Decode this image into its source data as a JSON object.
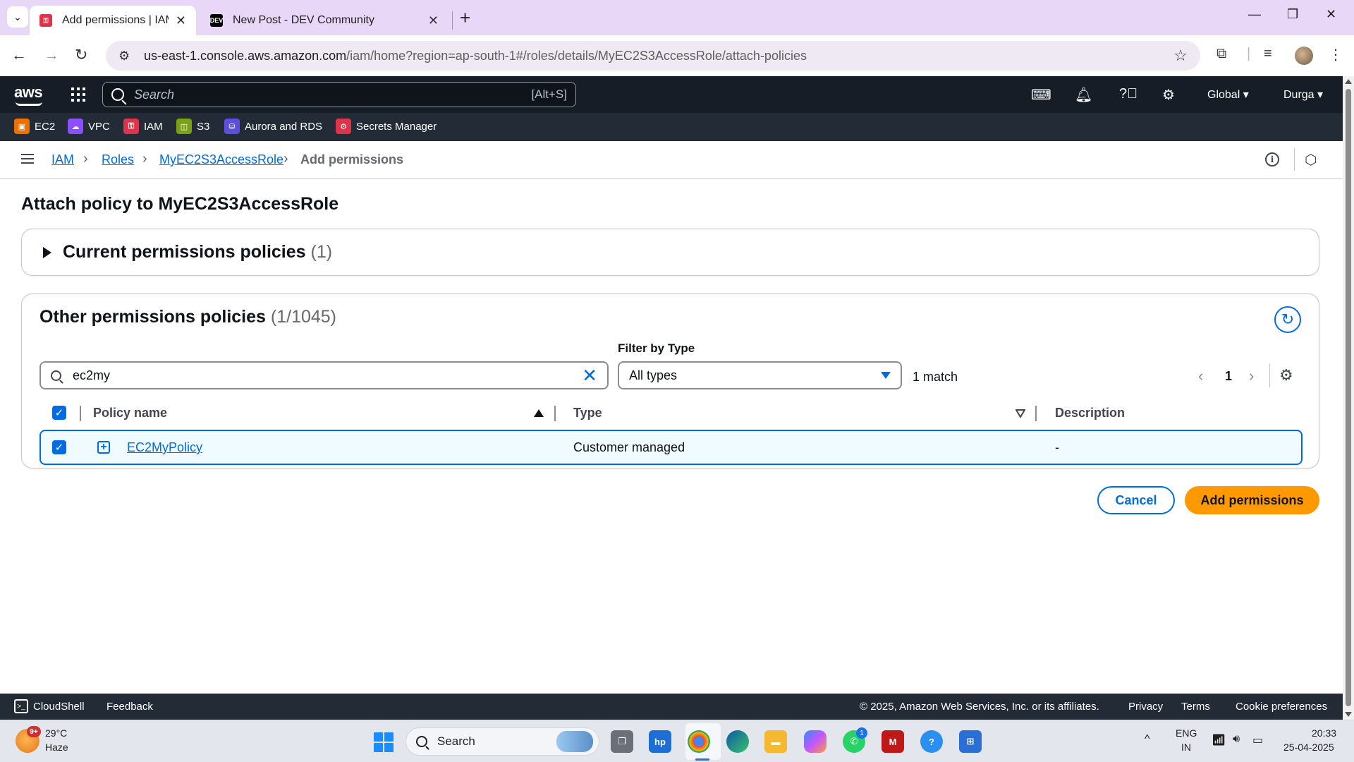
{
  "browser": {
    "tabs": [
      {
        "title": "Add permissions | IAM | Global",
        "favicon": "aws-iam-favicon",
        "active": true
      },
      {
        "title": "New Post - DEV Community",
        "favicon": "dev-favicon",
        "favicon_text": "DEV",
        "active": false
      }
    ],
    "url_host": "us-east-1.console.aws.amazon.com",
    "url_path": "/iam/home?region=ap-south-1#/roles/details/MyEC2S3AccessRole/attach-policies"
  },
  "aws_nav": {
    "logo": "aws",
    "search_placeholder": "Search",
    "search_shortcut": "[Alt+S]",
    "region": "Global",
    "user": "Durga"
  },
  "favorites": [
    {
      "label": "EC2",
      "color": "#ed7100"
    },
    {
      "label": "VPC",
      "color": "#8c4fff"
    },
    {
      "label": "IAM",
      "color": "#dd344c"
    },
    {
      "label": "S3",
      "color": "#7aa116"
    },
    {
      "label": "Aurora and RDS",
      "color": "#c925d1"
    },
    {
      "label": "Secrets Manager",
      "color": "#dd344c"
    }
  ],
  "breadcrumb": {
    "items": [
      "IAM",
      "Roles",
      "MyEC2S3AccessRole"
    ],
    "current": "Add permissions"
  },
  "page": {
    "title": "Attach policy to MyEC2S3AccessRole",
    "current_policies": {
      "label": "Current permissions policies",
      "count": "(1)"
    },
    "other_policies": {
      "label": "Other permissions policies",
      "count": "(1/1045)"
    },
    "search_value": "ec2my",
    "filter_label": "Filter by Type",
    "filter_value": "All types",
    "match_text": "1 match",
    "page_number": "1",
    "columns": [
      "Policy name",
      "Type",
      "Description"
    ],
    "rows": [
      {
        "name": "EC2MyPolicy",
        "type": "Customer managed",
        "description": "-",
        "selected": true
      }
    ],
    "cancel_label": "Cancel",
    "add_label": "Add permissions"
  },
  "footer": {
    "cloudshell": "CloudShell",
    "feedback": "Feedback",
    "copyright": "© 2025, Amazon Web Services, Inc. or its affiliates.",
    "privacy": "Privacy",
    "terms": "Terms",
    "cookies": "Cookie preferences"
  },
  "taskbar": {
    "temperature": "29°C",
    "weather": "Haze",
    "weather_badge": "9+",
    "search": "Search",
    "whatsapp_badge": "1",
    "lang_line1": "ENG",
    "lang_line2": "IN",
    "time": "20:33",
    "date": "25-04-2025"
  },
  "colors": {
    "accent": "#006ce0",
    "primary_button": "#ff9900",
    "aws_nav_bg": "#161d26"
  }
}
